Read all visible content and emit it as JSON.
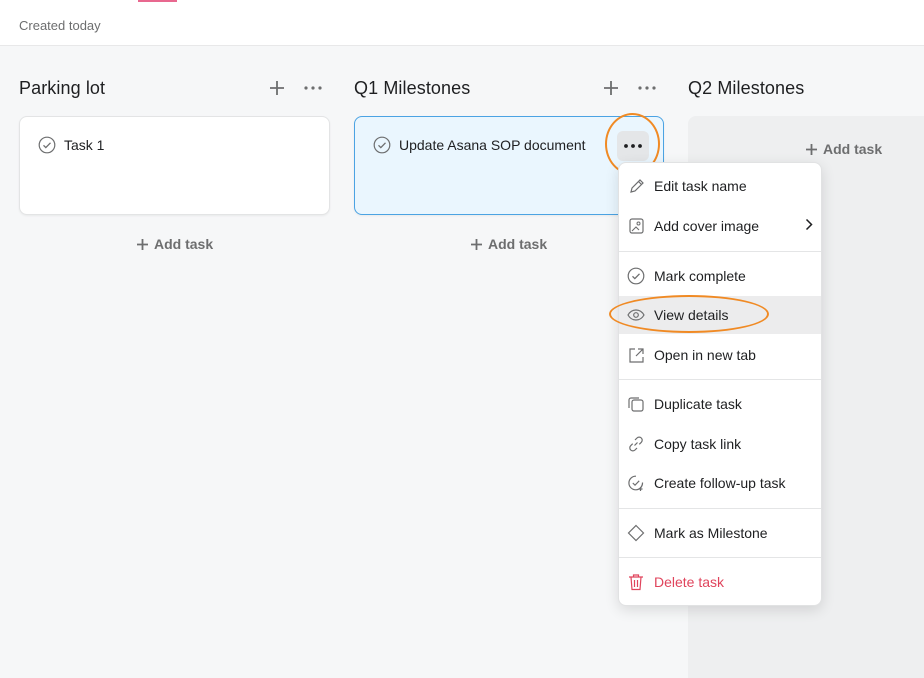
{
  "header": {
    "created_text": "Created today"
  },
  "columns": [
    {
      "title": "Parking lot",
      "tasks": [
        "Task 1"
      ],
      "add_task": "Add task"
    },
    {
      "title": "Q1 Milestones",
      "tasks": [
        "Update Asana SOP document"
      ],
      "add_task": "Add task"
    },
    {
      "title": "Q2 Milestones",
      "tasks": [],
      "add_task": "Add task"
    }
  ],
  "menu": {
    "items": [
      {
        "label": "Edit task name",
        "icon": "pencil-icon"
      },
      {
        "label": "Add cover image",
        "icon": "image-icon"
      },
      {
        "label": "Mark complete",
        "icon": "check-circle-icon"
      },
      {
        "label": "View details",
        "icon": "eye-icon"
      },
      {
        "label": "Open in new tab",
        "icon": "external-link-icon"
      },
      {
        "label": "Duplicate task",
        "icon": "duplicate-icon"
      },
      {
        "label": "Copy task link",
        "icon": "link-icon"
      },
      {
        "label": "Create follow-up task",
        "icon": "follow-up-icon"
      },
      {
        "label": "Mark as Milestone",
        "icon": "diamond-icon"
      },
      {
        "label": "Delete task",
        "icon": "trash-icon"
      }
    ]
  },
  "colors": {
    "accent_ring": "#f08a24",
    "selected_card_border": "#4ba3e3",
    "danger": "#e0445c"
  }
}
